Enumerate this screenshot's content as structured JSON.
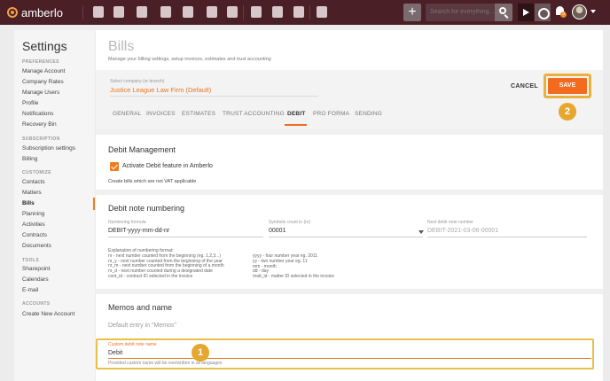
{
  "topbar": {
    "logo_text": "amberlo",
    "plus_label": "+",
    "search_placeholder": "Search for everything...",
    "notification_count": "3"
  },
  "sidebar": {
    "title": "Settings",
    "sections": [
      {
        "label": "PREFERENCES",
        "items": [
          "Manage Account",
          "Company Rates",
          "Manage Users",
          "Profile",
          "Notifications",
          "Recovery Bin"
        ]
      },
      {
        "label": "SUBSCRIPTION",
        "items": [
          "Subscription settings",
          "Billing"
        ]
      },
      {
        "label": "CUSTOMIZE",
        "items": [
          "Contacts",
          "Matters",
          "Bills",
          "Planning",
          "Activities",
          "Contracts",
          "Documents"
        ]
      },
      {
        "label": "TOOLS",
        "items": [
          "Sharepoint",
          "Calendars",
          "E-mail"
        ]
      },
      {
        "label": "ACCOUNTS",
        "items": [
          "Create New Account"
        ]
      }
    ],
    "active_item": "Bills"
  },
  "page": {
    "title": "Bills",
    "subtitle": "Manage your billing settings, setup invoices, estimates and trust accounting"
  },
  "company": {
    "label": "Select company (or branch)",
    "value": "Justice League Law Firm (Default)"
  },
  "actions": {
    "cancel": "CANCEL",
    "save": "SAVE"
  },
  "tabs": [
    "GENERAL",
    "INVOICES",
    "ESTIMATES",
    "TRUST ACCOUNTING",
    "DEBIT",
    "PRO FORMA",
    "SENDING"
  ],
  "active_tab": "DEBIT",
  "debit_management": {
    "title": "Debit Management",
    "checkbox_label": "Activate Debit feature in Amberlo",
    "checked": true,
    "note": "Create bills which are not VAT applicable"
  },
  "numbering": {
    "title": "Debit note numbering",
    "formula_label": "Numbering formula",
    "formula_value": "DEBIT-yyyy-mm-dd-nr",
    "symbols_label": "Symbols count in {nr}",
    "symbols_value": "00001",
    "next_label": "Next debit note number",
    "next_value": "DEBIT-2021-03-06-00001",
    "explanation_left": [
      "Explanation of numbering format:",
      "nr - next number counted from the beginning (eg. 1,2,3...)",
      "nr_y - next number counted from the beginning of the year",
      "nr_m - next number counted from the beginning of a month",
      "nr_d - next number counted during a designated date",
      "cont_id - contract ID selected in the invoice"
    ],
    "explanation_right": [
      "yyyy - four number year eg. 2011",
      "yy - two number year eg. 11",
      "mm - month",
      "dd - day",
      "matt_id - matter ID selected in the invoice"
    ]
  },
  "memos": {
    "title": "Memos and name",
    "default_entry": "Default entry in \"Memos\"",
    "custom_label": "Custom debit note name",
    "custom_value": "Debit",
    "custom_helper": "Provided custom name will be overwritten in all languages"
  },
  "badges": [
    "1",
    "2"
  ],
  "colors": {
    "topbar": "#4a1f26",
    "accent": "#f26b1f",
    "highlight": "#e5a72e"
  }
}
